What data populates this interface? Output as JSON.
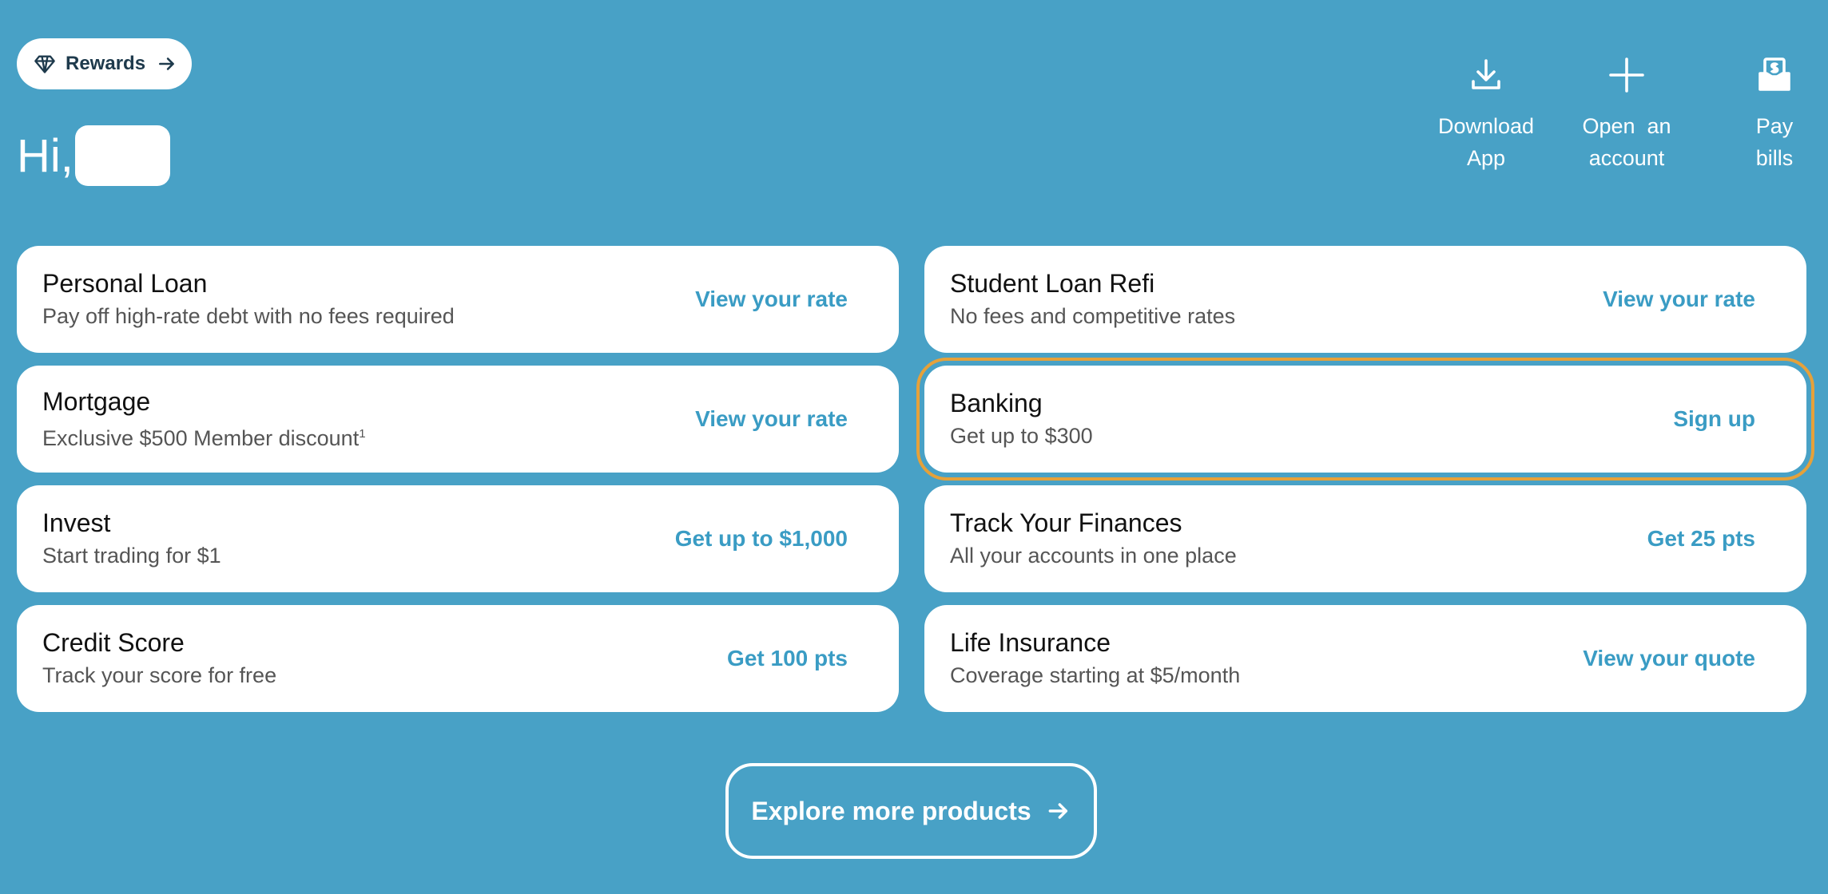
{
  "rewards": {
    "label": "Rewards",
    "icon": "diamond-icon"
  },
  "greeting": {
    "prefix": "Hi,"
  },
  "quick_actions": [
    {
      "label_line1": "Download",
      "label_line2": "App",
      "icon": "download-icon"
    },
    {
      "label_line1": "Open  an",
      "label_line2": "account",
      "icon": "plus-icon"
    },
    {
      "label_line1": "Pay",
      "label_line2": "bills",
      "icon": "bill-icon"
    }
  ],
  "products": [
    {
      "title": "Personal Loan",
      "subtitle": "Pay off high-rate debt with no fees required",
      "cta": "View your rate"
    },
    {
      "title": "Student Loan Refi",
      "subtitle": "No fees and competitive rates",
      "cta": "View your rate"
    },
    {
      "title": "Mortgage",
      "subtitle": "Exclusive $500 Member discount",
      "sup": "1",
      "cta": "View your rate"
    },
    {
      "title": "Banking",
      "subtitle": "Get up to $300",
      "cta": "Sign up"
    },
    {
      "title": "Invest",
      "subtitle": "Start trading for $1",
      "cta": "Get up to $1,000"
    },
    {
      "title": "Track Your Finances",
      "subtitle": "All your accounts in one place",
      "cta": "Get 25 pts"
    },
    {
      "title": "Credit Score",
      "subtitle": "Track your score for free",
      "cta": "Get 100 pts"
    },
    {
      "title": "Life Insurance",
      "subtitle": "Coverage starting at $5/month",
      "cta": "View your quote"
    }
  ],
  "explore": {
    "label": "Explore more products"
  },
  "colors": {
    "background": "#48a1c6",
    "accent": "#3a9cc4",
    "focus": "#e5a13a"
  }
}
